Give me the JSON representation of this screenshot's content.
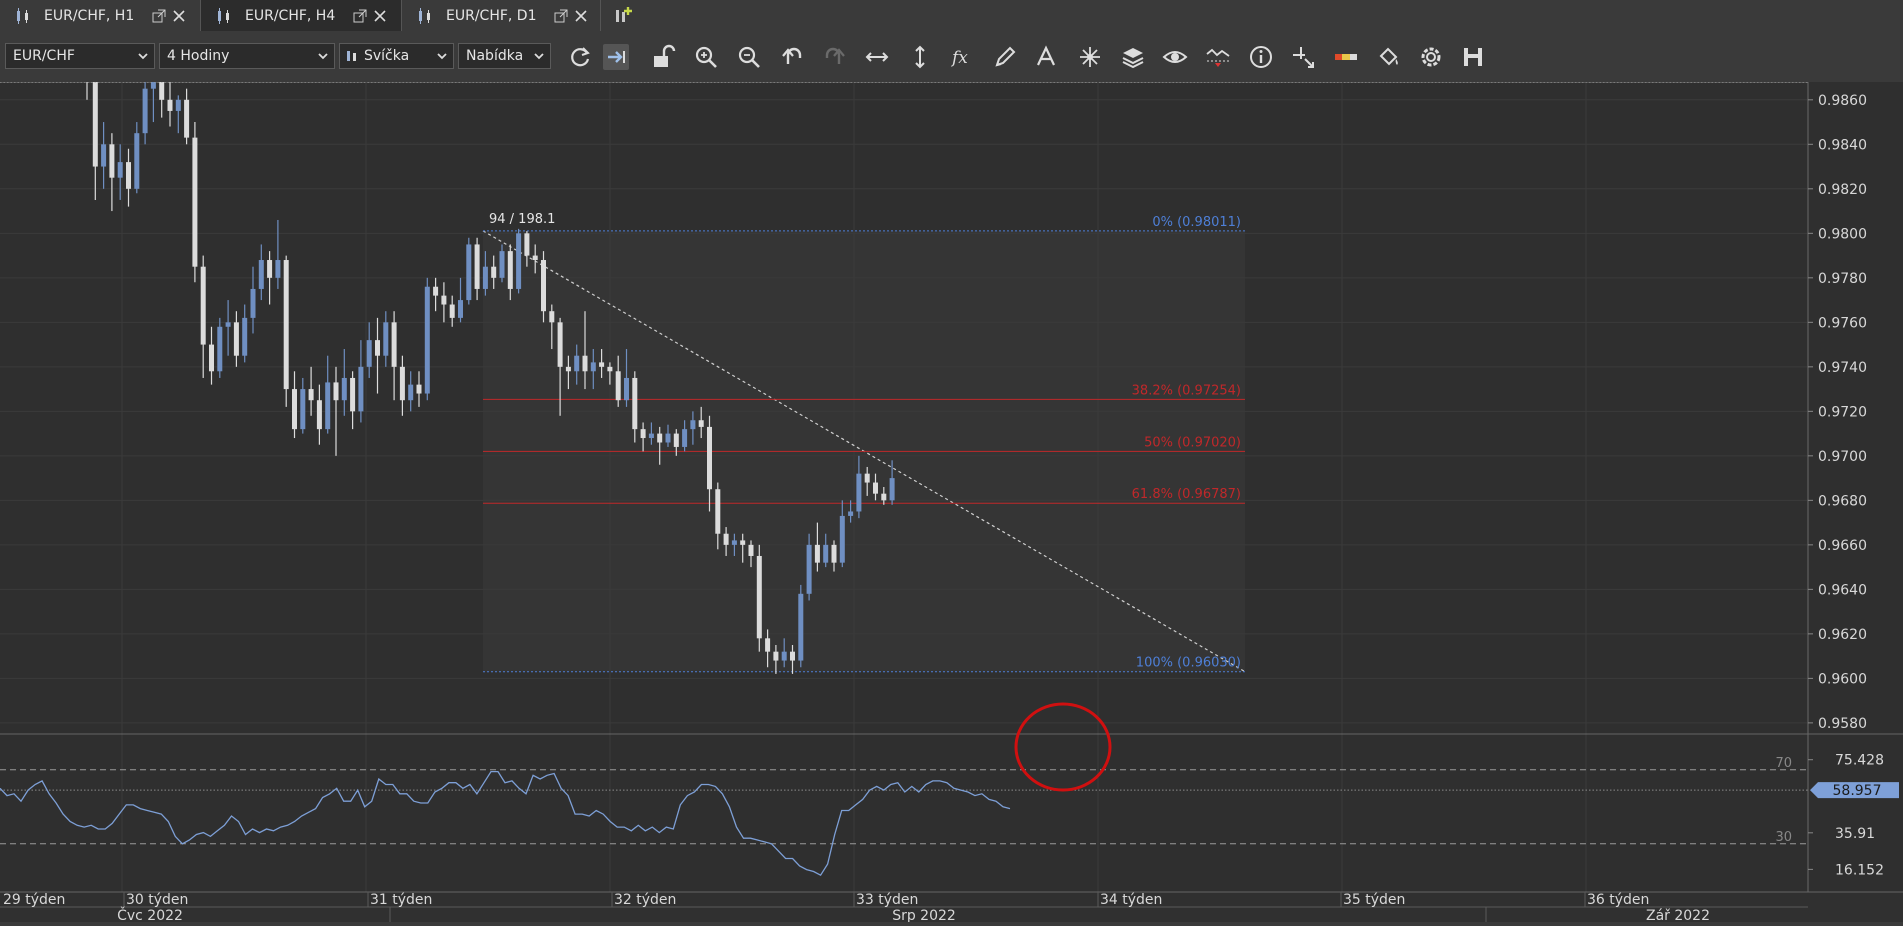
{
  "tabs": [
    {
      "label": "EUR/CHF, H1",
      "active": false
    },
    {
      "label": "EUR/CHF, H4",
      "active": true
    },
    {
      "label": "EUR/CHF, D1",
      "active": false
    }
  ],
  "toolbar": {
    "instrument": "EUR/CHF",
    "period": "4 Hodiny",
    "chart_type": "Svíčka",
    "price_side": "Nabídka",
    "buttons": [
      "refresh-icon",
      "auto-shift-icon",
      "unlock-icon",
      "zoom-in-icon",
      "zoom-out-icon",
      "undo-icon",
      "redo-icon",
      "horizontal-arrows-icon",
      "vertical-arrows-icon",
      "fx-icon",
      "pencil-icon",
      "text-icon",
      "star-tool-icon",
      "layers-icon",
      "eye-icon",
      "indicator-icon",
      "info-icon",
      "crosshair-icon",
      "ruler-icon",
      "paint-bucket-icon",
      "settings-icon",
      "save-icon"
    ]
  },
  "price_axis": {
    "labels": [
      "0.9860",
      "0.9840",
      "0.9820",
      "0.9800",
      "0.9780",
      "0.9760",
      "0.9740",
      "0.9720",
      "0.9700",
      "0.9680",
      "0.9660",
      "0.9640",
      "0.9620",
      "0.9600",
      "0.9580"
    ],
    "current_price": "0.96879",
    "current_color": "#b7cdea"
  },
  "fib": {
    "header": "94 / 198.1",
    "levels": [
      {
        "label": "0% (0.98011)",
        "color": "#4e7fd6",
        "price": 0.98011
      },
      {
        "label": "38.2% (0.97254)",
        "color": "#c0282a",
        "price": 0.97254
      },
      {
        "label": "50% (0.97020)",
        "color": "#c0282a",
        "price": 0.9702
      },
      {
        "label": "61.8% (0.96787)",
        "color": "#c0282a",
        "price": 0.96787
      },
      {
        "label": "100% (0.96030)",
        "color": "#4e7fd6",
        "price": 0.9603
      }
    ]
  },
  "rsi": {
    "level_70": "70",
    "level_30": "30",
    "axis_labels": [
      "75.428",
      "35.91",
      "16.152"
    ],
    "current": "58.957",
    "level_70_value": 70,
    "level_30_value": 30,
    "current_value": 58.957
  },
  "time_axis": {
    "weeks": [
      "29 týden",
      "30 týden",
      "31 týden",
      "32 týden",
      "33 týden",
      "34 týden",
      "35 týden",
      "36 týden"
    ],
    "months": [
      "Čvc 2022",
      "Srp 2022",
      "Zář 2022"
    ]
  },
  "colors": {
    "bull": "#6f8fc2",
    "bear": "#dcdcdc",
    "background": "#2f2f2f",
    "annotation_circle": "#d01010",
    "rsi_line": "#7d9fd6"
  },
  "chart_data": {
    "type": "candlestick",
    "ylim": [
      0.9575,
      0.9868
    ],
    "rsi_ylim": [
      5,
      85
    ],
    "candles": [
      [
        0.988,
        0.9875,
        0.9885,
        0.986
      ],
      [
        0.9875,
        0.983,
        0.9878,
        0.9815
      ],
      [
        0.983,
        0.984,
        0.985,
        0.982
      ],
      [
        0.984,
        0.9825,
        0.9845,
        0.981
      ],
      [
        0.9825,
        0.9832,
        0.984,
        0.9815
      ],
      [
        0.9832,
        0.982,
        0.9838,
        0.9812
      ],
      [
        0.982,
        0.9845,
        0.985,
        0.9818
      ],
      [
        0.9845,
        0.9865,
        0.987,
        0.984
      ],
      [
        0.9865,
        0.987,
        0.988,
        0.985
      ],
      [
        0.987,
        0.986,
        0.9875,
        0.9852
      ],
      [
        0.986,
        0.9855,
        0.9868,
        0.9848
      ],
      [
        0.9855,
        0.986,
        0.9862,
        0.9845
      ],
      [
        0.986,
        0.9843,
        0.9865,
        0.984
      ],
      [
        0.9843,
        0.9785,
        0.985,
        0.9778
      ],
      [
        0.9785,
        0.975,
        0.979,
        0.9735
      ],
      [
        0.975,
        0.9738,
        0.9758,
        0.9732
      ],
      [
        0.9738,
        0.9758,
        0.9762,
        0.9735
      ],
      [
        0.9758,
        0.976,
        0.977,
        0.9745
      ],
      [
        0.976,
        0.9745,
        0.9765,
        0.974
      ],
      [
        0.9745,
        0.9762,
        0.9768,
        0.9742
      ],
      [
        0.9762,
        0.9775,
        0.9785,
        0.9755
      ],
      [
        0.9775,
        0.9788,
        0.9795,
        0.977
      ],
      [
        0.9788,
        0.978,
        0.9792,
        0.9768
      ],
      [
        0.978,
        0.9788,
        0.9806,
        0.9775
      ],
      [
        0.9788,
        0.973,
        0.979,
        0.9722
      ],
      [
        0.973,
        0.9712,
        0.9738,
        0.9708
      ],
      [
        0.9712,
        0.973,
        0.9735,
        0.971
      ],
      [
        0.973,
        0.9725,
        0.974,
        0.9718
      ],
      [
        0.9725,
        0.9712,
        0.9732,
        0.9705
      ],
      [
        0.9712,
        0.9733,
        0.9745,
        0.971
      ],
      [
        0.9733,
        0.9725,
        0.974,
        0.97
      ],
      [
        0.9725,
        0.9735,
        0.9748,
        0.9718
      ],
      [
        0.9735,
        0.972,
        0.9738,
        0.9712
      ],
      [
        0.972,
        0.974,
        0.9752,
        0.9715
      ],
      [
        0.974,
        0.9752,
        0.976,
        0.9735
      ],
      [
        0.9752,
        0.9745,
        0.9762,
        0.9728
      ],
      [
        0.9745,
        0.976,
        0.9765,
        0.974
      ],
      [
        0.976,
        0.974,
        0.9765,
        0.9725
      ],
      [
        0.974,
        0.9725,
        0.9745,
        0.9718
      ],
      [
        0.9725,
        0.9732,
        0.9738,
        0.972
      ],
      [
        0.9732,
        0.9728,
        0.9738,
        0.9722
      ],
      [
        0.9728,
        0.9776,
        0.978,
        0.9725
      ],
      [
        0.9776,
        0.9772,
        0.978,
        0.9765
      ],
      [
        0.9772,
        0.9768,
        0.9778,
        0.976
      ],
      [
        0.9768,
        0.9762,
        0.9772,
        0.9758
      ],
      [
        0.9762,
        0.977,
        0.978,
        0.976
      ],
      [
        0.977,
        0.9795,
        0.9798,
        0.9768
      ],
      [
        0.9795,
        0.9775,
        0.9798,
        0.977
      ],
      [
        0.9775,
        0.9785,
        0.9792,
        0.9772
      ],
      [
        0.9785,
        0.978,
        0.979,
        0.9775
      ],
      [
        0.978,
        0.9792,
        0.9795,
        0.9778
      ],
      [
        0.9792,
        0.9775,
        0.9795,
        0.977
      ],
      [
        0.9775,
        0.98,
        0.9802,
        0.9773
      ],
      [
        0.98,
        0.979,
        0.9801,
        0.9785
      ],
      [
        0.979,
        0.9788,
        0.9795,
        0.9782
      ],
      [
        0.9788,
        0.9765,
        0.9792,
        0.976
      ],
      [
        0.9765,
        0.976,
        0.9768,
        0.9748
      ],
      [
        0.976,
        0.974,
        0.9762,
        0.9718
      ],
      [
        0.974,
        0.9738,
        0.9745,
        0.973
      ],
      [
        0.9738,
        0.9745,
        0.975,
        0.9732
      ],
      [
        0.9745,
        0.9738,
        0.9765,
        0.973
      ],
      [
        0.9738,
        0.9742,
        0.9748,
        0.973
      ],
      [
        0.9742,
        0.974,
        0.9748,
        0.9735
      ],
      [
        0.974,
        0.9738,
        0.9742,
        0.9732
      ],
      [
        0.9738,
        0.9725,
        0.9745,
        0.9722
      ],
      [
        0.9725,
        0.9735,
        0.9748,
        0.9722
      ],
      [
        0.9735,
        0.9712,
        0.9738,
        0.9706
      ],
      [
        0.9712,
        0.9708,
        0.9715,
        0.9702
      ],
      [
        0.9708,
        0.971,
        0.9715,
        0.9705
      ],
      [
        0.971,
        0.9706,
        0.9713,
        0.9696
      ],
      [
        0.9706,
        0.971,
        0.9714,
        0.9704
      ],
      [
        0.971,
        0.9704,
        0.9712,
        0.97
      ],
      [
        0.9704,
        0.9712,
        0.9716,
        0.9702
      ],
      [
        0.9712,
        0.9716,
        0.972,
        0.9705
      ],
      [
        0.9716,
        0.9713,
        0.9722,
        0.9708
      ],
      [
        0.9713,
        0.9685,
        0.9718,
        0.9675
      ],
      [
        0.9685,
        0.9665,
        0.9688,
        0.9658
      ],
      [
        0.9665,
        0.966,
        0.9668,
        0.9655
      ],
      [
        0.966,
        0.9662,
        0.9665,
        0.9655
      ],
      [
        0.9662,
        0.966,
        0.9665,
        0.9652
      ],
      [
        0.966,
        0.9655,
        0.9662,
        0.965
      ],
      [
        0.9655,
        0.9618,
        0.966,
        0.9612
      ],
      [
        0.9618,
        0.9612,
        0.9622,
        0.9605
      ],
      [
        0.9612,
        0.9608,
        0.9615,
        0.9602
      ],
      [
        0.9608,
        0.9612,
        0.9618,
        0.9605
      ],
      [
        0.9612,
        0.9608,
        0.9615,
        0.9602
      ],
      [
        0.9608,
        0.9638,
        0.9642,
        0.9605
      ],
      [
        0.9638,
        0.966,
        0.9665,
        0.9635
      ],
      [
        0.966,
        0.9652,
        0.967,
        0.9648
      ],
      [
        0.9652,
        0.966,
        0.9665,
        0.965
      ],
      [
        0.966,
        0.9652,
        0.9662,
        0.9648
      ],
      [
        0.9652,
        0.9673,
        0.968,
        0.965
      ],
      [
        0.9673,
        0.9675,
        0.968,
        0.967
      ],
      [
        0.9675,
        0.9692,
        0.97,
        0.9672
      ],
      [
        0.9692,
        0.9688,
        0.9695,
        0.9682
      ],
      [
        0.9688,
        0.9683,
        0.9692,
        0.968
      ],
      [
        0.9683,
        0.968,
        0.9686,
        0.9678
      ],
      [
        0.968,
        0.969,
        0.9698,
        0.9678
      ]
    ],
    "rsi": [
      60,
      56,
      57,
      53,
      59,
      62,
      64,
      57,
      52,
      46,
      42,
      40,
      39,
      40,
      38,
      38,
      41,
      46,
      51,
      51,
      49,
      48,
      47,
      46,
      42,
      34,
      30,
      32,
      35,
      36,
      34,
      37,
      40,
      45,
      42,
      35,
      38,
      36,
      38,
      37,
      39,
      40,
      42,
      45,
      47,
      49,
      55,
      57,
      60,
      53,
      53,
      59,
      50,
      53,
      65,
      62,
      62,
      57,
      57,
      53,
      52,
      52,
      58,
      60,
      63,
      63,
      60,
      62,
      57,
      63,
      69,
      69,
      63,
      64,
      60,
      57,
      67,
      65,
      67,
      68,
      60,
      56,
      46,
      46,
      45,
      48,
      46,
      42,
      39,
      39,
      37,
      40,
      37,
      39,
      36,
      39,
      38,
      51,
      56,
      58,
      62,
      62,
      61,
      57,
      50,
      39,
      33,
      33,
      32,
      31,
      30,
      26,
      22,
      22,
      18,
      16,
      15,
      13,
      19,
      35,
      48,
      48,
      51,
      54,
      59,
      61,
      59,
      62,
      63,
      58,
      61,
      58,
      62,
      64,
      64,
      63,
      60,
      59,
      58,
      56,
      57,
      54,
      53,
      50,
      49
    ]
  }
}
